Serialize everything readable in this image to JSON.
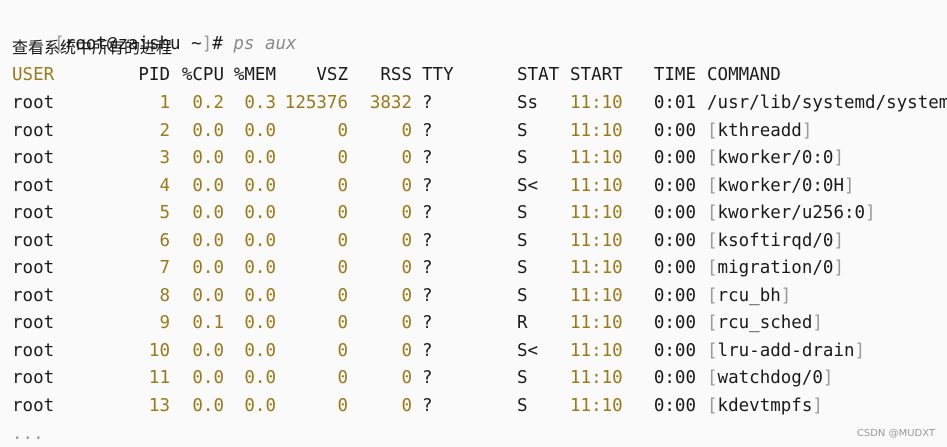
{
  "prompt": {
    "open_bracket": "[",
    "user_host": "root@zaishu",
    "cwd": "~",
    "close_bracket": "]",
    "symbol": "#",
    "command": "ps aux"
  },
  "note": "查看系统中所有的进程",
  "headers": {
    "user": "USER",
    "pid": "PID",
    "cpu": "%CPU",
    "mem": "%MEM",
    "vsz": "VSZ",
    "rss": "RSS",
    "tty": "TTY",
    "stat": "STAT",
    "start": "START",
    "time": "TIME",
    "command": "COMMAND"
  },
  "rows": [
    {
      "user": "root",
      "pid": "1",
      "cpu": "0.2",
      "mem": "0.3",
      "vsz": "125376",
      "rss": "3832",
      "tty": "?",
      "stat": "Ss",
      "start": "11:10",
      "time": "0:01",
      "command": "/usr/lib/systemd/systemd"
    },
    {
      "user": "root",
      "pid": "2",
      "cpu": "0.0",
      "mem": "0.0",
      "vsz": "0",
      "rss": "0",
      "tty": "?",
      "stat": "S",
      "start": "11:10",
      "time": "0:00",
      "command": "kthreadd"
    },
    {
      "user": "root",
      "pid": "3",
      "cpu": "0.0",
      "mem": "0.0",
      "vsz": "0",
      "rss": "0",
      "tty": "?",
      "stat": "S",
      "start": "11:10",
      "time": "0:00",
      "command": "kworker/0:0"
    },
    {
      "user": "root",
      "pid": "4",
      "cpu": "0.0",
      "mem": "0.0",
      "vsz": "0",
      "rss": "0",
      "tty": "?",
      "stat": "S<",
      "start": "11:10",
      "time": "0:00",
      "command": "kworker/0:0H"
    },
    {
      "user": "root",
      "pid": "5",
      "cpu": "0.0",
      "mem": "0.0",
      "vsz": "0",
      "rss": "0",
      "tty": "?",
      "stat": "S",
      "start": "11:10",
      "time": "0:00",
      "command": "kworker/u256:0"
    },
    {
      "user": "root",
      "pid": "6",
      "cpu": "0.0",
      "mem": "0.0",
      "vsz": "0",
      "rss": "0",
      "tty": "?",
      "stat": "S",
      "start": "11:10",
      "time": "0:00",
      "command": "ksoftirqd/0"
    },
    {
      "user": "root",
      "pid": "7",
      "cpu": "0.0",
      "mem": "0.0",
      "vsz": "0",
      "rss": "0",
      "tty": "?",
      "stat": "S",
      "start": "11:10",
      "time": "0:00",
      "command": "migration/0"
    },
    {
      "user": "root",
      "pid": "8",
      "cpu": "0.0",
      "mem": "0.0",
      "vsz": "0",
      "rss": "0",
      "tty": "?",
      "stat": "S",
      "start": "11:10",
      "time": "0:00",
      "command": "rcu_bh"
    },
    {
      "user": "root",
      "pid": "9",
      "cpu": "0.1",
      "mem": "0.0",
      "vsz": "0",
      "rss": "0",
      "tty": "?",
      "stat": "R",
      "start": "11:10",
      "time": "0:00",
      "command": "rcu_sched"
    },
    {
      "user": "root",
      "pid": "10",
      "cpu": "0.0",
      "mem": "0.0",
      "vsz": "0",
      "rss": "0",
      "tty": "?",
      "stat": "S<",
      "start": "11:10",
      "time": "0:00",
      "command": "lru-add-drain"
    },
    {
      "user": "root",
      "pid": "11",
      "cpu": "0.0",
      "mem": "0.0",
      "vsz": "0",
      "rss": "0",
      "tty": "?",
      "stat": "S",
      "start": "11:10",
      "time": "0:00",
      "command": "watchdog/0"
    },
    {
      "user": "root",
      "pid": "13",
      "cpu": "0.0",
      "mem": "0.0",
      "vsz": "0",
      "rss": "0",
      "tty": "?",
      "stat": "S",
      "start": "11:10",
      "time": "0:00",
      "command": "kdevtmpfs"
    }
  ],
  "ellipsis": "...",
  "watermark": "CSDN @MUDXT",
  "colors": {
    "accent": "#9b7a1a",
    "text": "#1a1a1a",
    "muted": "#9a9a9a",
    "background": "#fafafa"
  }
}
